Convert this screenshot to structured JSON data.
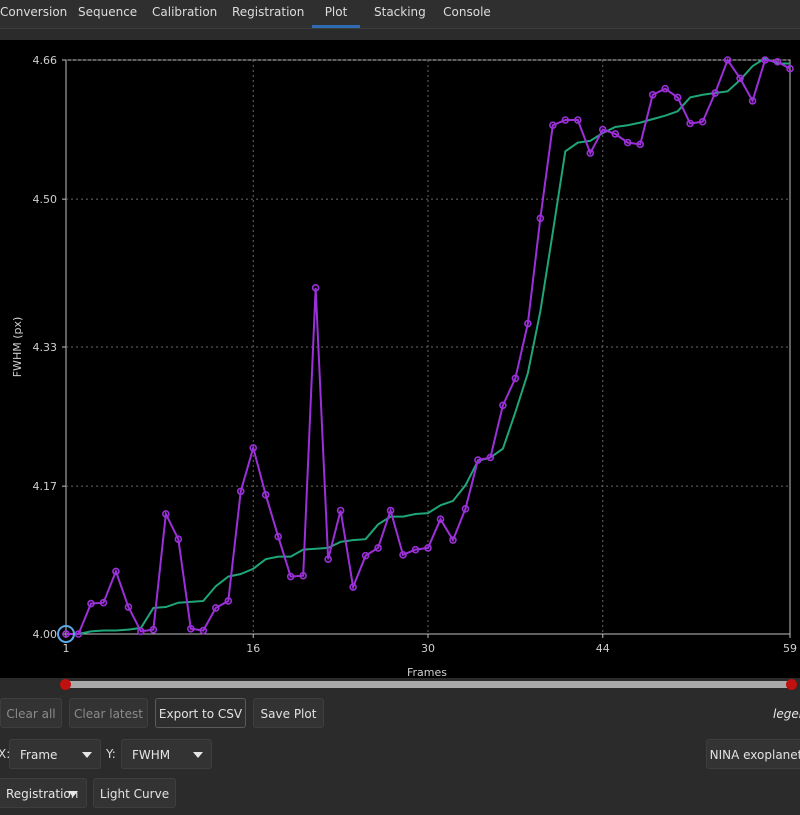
{
  "tabs": [
    {
      "label": "Conversion",
      "active": false
    },
    {
      "label": "Sequence",
      "active": false
    },
    {
      "label": "Calibration",
      "active": false
    },
    {
      "label": "Registration",
      "active": false
    },
    {
      "label": "Plot",
      "active": true
    },
    {
      "label": "Stacking",
      "active": false
    },
    {
      "label": "Console",
      "active": false
    }
  ],
  "chart_data": {
    "type": "line",
    "xlabel": "Frames",
    "ylabel": "FWHM (px)",
    "x_ticks": [
      "1",
      "16",
      "30",
      "44",
      "59"
    ],
    "y_ticks": [
      "4.00",
      "4.17",
      "4.33",
      "4.50",
      "4.66"
    ],
    "xlim": [
      1,
      59
    ],
    "ylim": [
      4.0,
      4.66
    ],
    "grid": true,
    "colors": {
      "raw": "#9b30d8",
      "smoothed": "#1fa57a",
      "selected": "#5aa9e6"
    },
    "selected_point": {
      "x": 1,
      "y": 4.0
    },
    "series": [
      {
        "values": [
          [
            1,
            4.0
          ],
          [
            2,
            4.0
          ],
          [
            3,
            4.035
          ],
          [
            4,
            4.036
          ],
          [
            5,
            4.072
          ],
          [
            6,
            4.031
          ],
          [
            7,
            4.003
          ],
          [
            8,
            4.005
          ],
          [
            9,
            4.138
          ],
          [
            10,
            4.109
          ],
          [
            11,
            4.006
          ],
          [
            12,
            4.004
          ],
          [
            13,
            4.03
          ],
          [
            14,
            4.038
          ],
          [
            15,
            4.164
          ],
          [
            16,
            4.214
          ],
          [
            17,
            4.16
          ],
          [
            18,
            4.112
          ],
          [
            19,
            4.066
          ],
          [
            20,
            4.067
          ],
          [
            21,
            4.398
          ],
          [
            22,
            4.086
          ],
          [
            23,
            4.142
          ],
          [
            24,
            4.054
          ],
          [
            25,
            4.09
          ],
          [
            26,
            4.099
          ],
          [
            27,
            4.142
          ],
          [
            28,
            4.091
          ],
          [
            29,
            4.097
          ],
          [
            30,
            4.099
          ],
          [
            31,
            4.132
          ],
          [
            32,
            4.108
          ],
          [
            33,
            4.144
          ],
          [
            34,
            4.2
          ],
          [
            35,
            4.203
          ],
          [
            36,
            4.263
          ],
          [
            37,
            4.294
          ],
          [
            38,
            4.357
          ],
          [
            39,
            4.478
          ],
          [
            40,
            4.585
          ],
          [
            41,
            4.591
          ],
          [
            42,
            4.591
          ],
          [
            43,
            4.553
          ],
          [
            44,
            4.58
          ],
          [
            45,
            4.575
          ],
          [
            46,
            4.565
          ],
          [
            47,
            4.563
          ],
          [
            48,
            4.62
          ],
          [
            49,
            4.627
          ],
          [
            50,
            4.617
          ],
          [
            51,
            4.587
          ],
          [
            52,
            4.589
          ],
          [
            53,
            4.622
          ],
          [
            54,
            4.66
          ],
          [
            55,
            4.639
          ],
          [
            56,
            4.613
          ],
          [
            57,
            4.66
          ],
          [
            58,
            4.658
          ],
          [
            59,
            4.65
          ]
        ]
      },
      {
        "values": [
          [
            1,
            4.0
          ],
          [
            2,
            4.0
          ],
          [
            3,
            4.003
          ],
          [
            4,
            4.004
          ],
          [
            5,
            4.004
          ],
          [
            6,
            4.005
          ],
          [
            7,
            4.007
          ],
          [
            8,
            4.03
          ],
          [
            9,
            4.031
          ],
          [
            10,
            4.036
          ],
          [
            11,
            4.037
          ],
          [
            12,
            4.038
          ],
          [
            13,
            4.055
          ],
          [
            14,
            4.066
          ],
          [
            15,
            4.069
          ],
          [
            16,
            4.075
          ],
          [
            17,
            4.086
          ],
          [
            18,
            4.089
          ],
          [
            19,
            4.089
          ],
          [
            20,
            4.097
          ],
          [
            21,
            4.098
          ],
          [
            22,
            4.099
          ],
          [
            23,
            4.106
          ],
          [
            24,
            4.108
          ],
          [
            25,
            4.109
          ],
          [
            26,
            4.126
          ],
          [
            27,
            4.135
          ],
          [
            28,
            4.135
          ],
          [
            29,
            4.138
          ],
          [
            30,
            4.139
          ],
          [
            31,
            4.148
          ],
          [
            32,
            4.153
          ],
          [
            33,
            4.171
          ],
          [
            34,
            4.199
          ],
          [
            35,
            4.203
          ],
          [
            36,
            4.213
          ],
          [
            37,
            4.255
          ],
          [
            38,
            4.3
          ],
          [
            39,
            4.371
          ],
          [
            40,
            4.462
          ],
          [
            41,
            4.555
          ],
          [
            42,
            4.565
          ],
          [
            43,
            4.567
          ],
          [
            44,
            4.576
          ],
          [
            45,
            4.583
          ],
          [
            46,
            4.585
          ],
          [
            47,
            4.588
          ],
          [
            48,
            4.592
          ],
          [
            49,
            4.596
          ],
          [
            50,
            4.601
          ],
          [
            51,
            4.617
          ],
          [
            52,
            4.62
          ],
          [
            53,
            4.622
          ],
          [
            54,
            4.624
          ],
          [
            55,
            4.637
          ],
          [
            56,
            4.653
          ],
          [
            57,
            4.662
          ],
          [
            58,
            4.656
          ],
          [
            59,
            4.656
          ]
        ]
      }
    ]
  },
  "range_slider": {
    "start": 0.0,
    "end": 1.0
  },
  "buttons": {
    "clear_all": "Clear all",
    "clear_latest": "Clear latest",
    "export_csv": "Export to CSV",
    "save_plot": "Save Plot",
    "light_curve": "Light Curve",
    "nina_exoplanet": "NINA exoplanet"
  },
  "legend_label": "legend",
  "x_axis_label": "X:",
  "x_axis_value": "Frame",
  "y_axis_label": "Y:",
  "y_axis_value": "FWHM",
  "source_dropdown": "Registration"
}
